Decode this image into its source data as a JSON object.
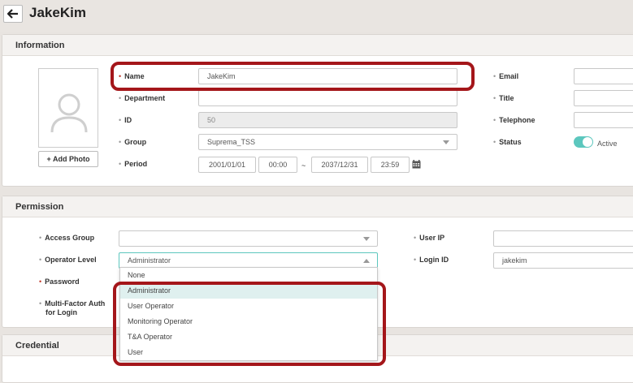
{
  "header": {
    "title": "JakeKim"
  },
  "information": {
    "title": "Information",
    "add_photo": "+ Add Photo",
    "name_label": "Name",
    "name_value": "JakeKim",
    "department_label": "Department",
    "department_value": "",
    "id_label": "ID",
    "id_value": "50",
    "group_label": "Group",
    "group_value": "Suprema_TSS",
    "period_label": "Period",
    "period_start_date": "2001/01/01",
    "period_start_time": "00:00",
    "period_sep": "~",
    "period_end_date": "2037/12/31",
    "period_end_time": "23:59",
    "email_label": "Email",
    "email_value": "",
    "title_label": "Title",
    "title_value": "",
    "telephone_label": "Telephone",
    "telephone_value": "",
    "status_label": "Status",
    "status_value": "Active"
  },
  "permission": {
    "title": "Permission",
    "access_group_label": "Access Group",
    "access_group_value": "",
    "operator_level_label": "Operator Level",
    "operator_level_value": "Administrator",
    "password_label": "Password",
    "mfa_label_line1": "Multi-Factor Auth",
    "mfa_label_line2": "for Login",
    "user_ip_label": "User IP",
    "user_ip_value": "",
    "login_id_label": "Login ID",
    "login_id_value": "jakekim"
  },
  "operator_level_options": [
    "None",
    "Administrator",
    "User Operator",
    "Monitoring Operator",
    "T&A Operator",
    "User"
  ],
  "credential": {
    "title": "Credential"
  },
  "colors": {
    "highlight": "#a4161a",
    "toggle_on": "#5cc7be",
    "required_dot": "#c0392b"
  }
}
